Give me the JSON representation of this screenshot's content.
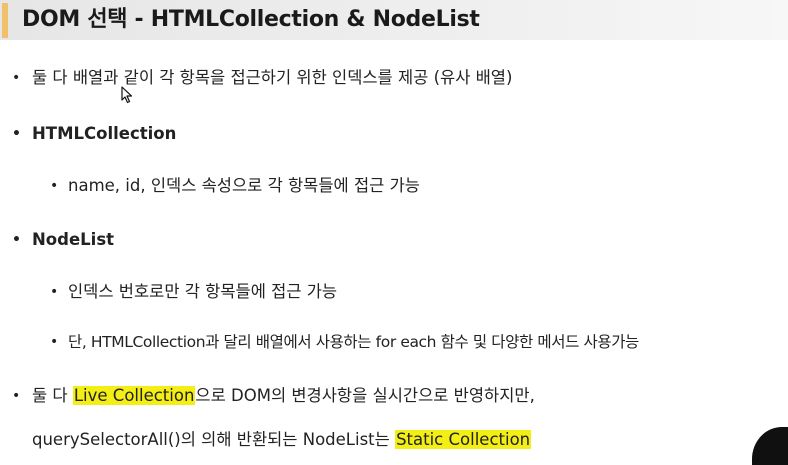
{
  "title": "DOM 선택 - HTMLCollection & NodeList",
  "bullets": {
    "b1": "둘 다 배열과 같이 각 항목을 접근하기 위한 인덱스를 제공 (유사 배열)",
    "h1": "HTMLCollection",
    "h1_sub1": "name, id, 인덱스 속성으로 각 항목들에 접근 가능",
    "h2": "NodeList",
    "h2_sub1": "인덱스 번호로만 각 항목들에 접근 가능",
    "h2_sub2": "단, HTMLCollection과 달리 배열에서 사용하는 for each 함수 및 다양한 메서드 사용가능",
    "b4_pre": "둘 다 ",
    "b4_hl": "Live Collection",
    "b4_post": "으로 DOM의 변경사항을 실시간으로 반영하지만,",
    "b5_pre": "querySelectorAll()의 의해 반환되는 NodeList는 ",
    "b5_hl": "Static Collection"
  },
  "bullet_glyph": "•",
  "colors": {
    "title_accent": "#f0c06a",
    "highlight": "#f3ee15"
  },
  "icons": {
    "cursor": "mouse-pointer-icon"
  }
}
